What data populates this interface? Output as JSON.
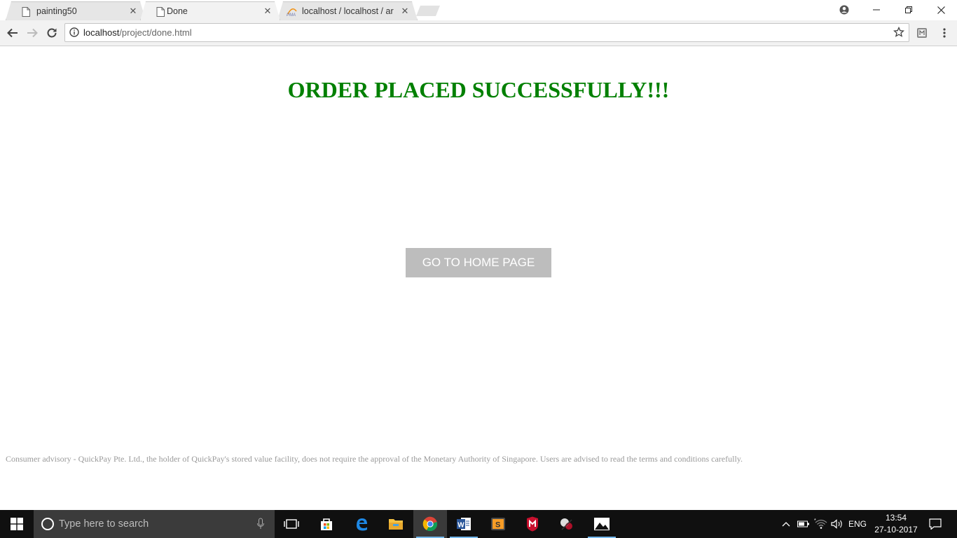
{
  "browser": {
    "tabs": [
      {
        "title": "painting50",
        "icon": "page-icon",
        "close": "✕"
      },
      {
        "title": "Done",
        "icon": "page-icon",
        "close": "✕"
      },
      {
        "title": "localhost / localhost / ar",
        "icon": "pma-icon",
        "close": "✕"
      }
    ],
    "address": {
      "host": "localhost",
      "path": "/project/done.html"
    }
  },
  "page": {
    "title": "ORDER PLACED SUCCESSFULLY!!!",
    "home_button": "GO TO HOME PAGE",
    "advisory": "Consumer advisory - QuickPay Pte. Ltd., the holder of QuickPay's stored value facility, does not require the approval of the Monetary Authority of Singapore. Users are advised to read the terms and conditions carefully."
  },
  "taskbar": {
    "search_placeholder": "Type here to search",
    "language": "ENG",
    "time": "13:54",
    "date": "27-10-2017"
  },
  "colors": {
    "title_green": "#008000",
    "button_gray": "#bdbdbd",
    "advisory_gray": "#9a9a9a",
    "taskbar": "#101010"
  }
}
